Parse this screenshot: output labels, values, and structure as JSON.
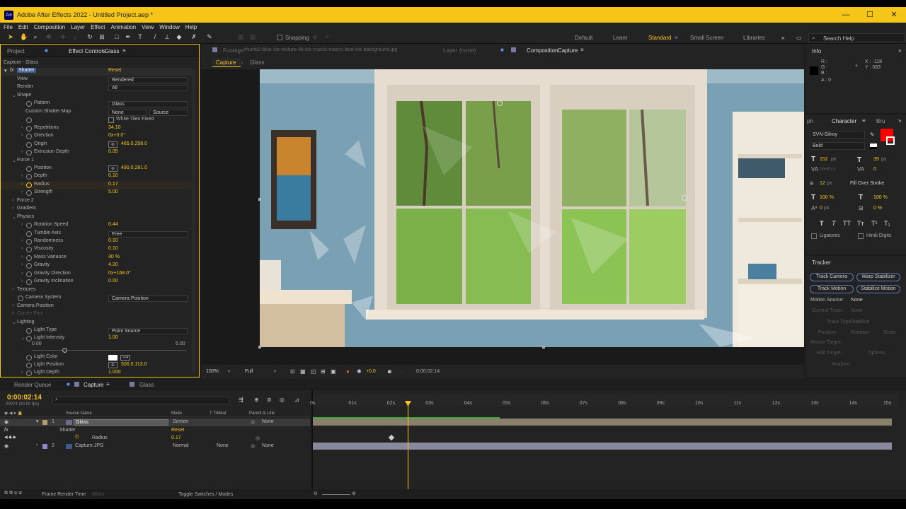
{
  "app": {
    "title": "Adobe After Effects 2022 - Untitled Project.aep *",
    "icon_text": "Ae",
    "window_buttons": [
      "—",
      "☐",
      "✕"
    ],
    "menu": [
      "File",
      "Edit",
      "Composition",
      "Layer",
      "Effect",
      "Animation",
      "View",
      "Window",
      "Help"
    ]
  },
  "toolbar": {
    "snapping_label": "Snapping",
    "workspaces": [
      "Default",
      "Learn",
      "Standard",
      "Small Screen",
      "Libraries"
    ],
    "active_workspace": "Standard",
    "search_help": "Search Help"
  },
  "effect_controls": {
    "tab_project": "Project",
    "tab_effect": "Effect Controls",
    "tab_effect_layer": "Glass",
    "breadcrumb": "Capture - Glass",
    "effect_name": "Shatter",
    "reset": "Reset",
    "rows": [
      {
        "label": "View",
        "type": "drop",
        "value": "Rendered",
        "indent": 16
      },
      {
        "label": "Render",
        "type": "drop",
        "value": "All",
        "indent": 16
      },
      {
        "label": "Shape",
        "type": "group",
        "indent": 16
      },
      {
        "label": "Pattern",
        "type": "drop",
        "value": "Glass",
        "indent": 28,
        "sw": true
      },
      {
        "label": "Custom Shatter Map",
        "type": "drop2",
        "value": "None",
        "value2": "Source",
        "indent": 28
      },
      {
        "label": "",
        "type": "check",
        "value": "White Tiles Fixed",
        "indent": 28,
        "sw": true
      },
      {
        "label": "Repetitions",
        "type": "val",
        "value": "34.10",
        "indent": 28,
        "sw": true,
        "tw": true
      },
      {
        "label": "Direction",
        "type": "val",
        "value": "0x+0.0°",
        "indent": 28,
        "sw": true,
        "tw": true
      },
      {
        "label": "Origin",
        "type": "point",
        "value": "465.0,258.0",
        "indent": 28,
        "sw": true
      },
      {
        "label": "Extrusion Depth",
        "type": "val",
        "value": "0.05",
        "indent": 28,
        "sw": true,
        "tw": true
      },
      {
        "label": "Force 1",
        "type": "group",
        "indent": 16
      },
      {
        "label": "Position",
        "type": "point",
        "value": "490.0,281.0",
        "indent": 28,
        "sw": true
      },
      {
        "label": "Depth",
        "type": "val",
        "value": "0.10",
        "indent": 28,
        "sw": true,
        "tw": true
      },
      {
        "label": "Radius",
        "type": "val",
        "value": "0.17",
        "indent": 28,
        "sw": true,
        "tw": true,
        "key": true
      },
      {
        "label": "Strength",
        "type": "val",
        "value": "5.00",
        "indent": 28,
        "sw": true,
        "tw": true
      },
      {
        "label": "Force 2",
        "type": "group",
        "indent": 16,
        "closed": true
      },
      {
        "label": "Gradient",
        "type": "group",
        "indent": 16,
        "closed": true
      },
      {
        "label": "Physics",
        "type": "group",
        "indent": 16
      },
      {
        "label": "Rotation Speed",
        "type": "val",
        "value": "0.44",
        "indent": 28,
        "sw": true,
        "tw": true
      },
      {
        "label": "Tumble Axis",
        "type": "drop",
        "value": "Free",
        "indent": 28,
        "sw": true
      },
      {
        "label": "Randomness",
        "type": "val",
        "value": "0.10",
        "indent": 28,
        "sw": true,
        "tw": true
      },
      {
        "label": "Viscosity",
        "type": "val",
        "value": "0.10",
        "indent": 28,
        "sw": true,
        "tw": true
      },
      {
        "label": "Mass Variance",
        "type": "val",
        "value": "30 %",
        "indent": 28,
        "sw": true,
        "tw": true
      },
      {
        "label": "Gravity",
        "type": "val",
        "value": "4.20",
        "indent": 28,
        "sw": true,
        "tw": true
      },
      {
        "label": "Gravity Direction",
        "type": "val",
        "value": "0x+168.0°",
        "indent": 28,
        "sw": true,
        "tw": true
      },
      {
        "label": "Gravity Inclination",
        "type": "val",
        "value": "0.00",
        "indent": 28,
        "sw": true,
        "tw": true
      },
      {
        "label": "Textures",
        "type": "group",
        "indent": 16,
        "closed": true
      },
      {
        "label": "Camera System",
        "type": "drop",
        "value": "Camera Position",
        "indent": 16,
        "sw": true
      },
      {
        "label": "Camera Position",
        "type": "group",
        "indent": 16,
        "closed": true
      },
      {
        "label": "Corner Pins",
        "type": "group",
        "indent": 16,
        "closed": true,
        "dim": true
      },
      {
        "label": "Lighting",
        "type": "group",
        "indent": 16
      },
      {
        "label": "Light Type",
        "type": "drop",
        "value": "Point Source",
        "indent": 28,
        "sw": true
      },
      {
        "label": "Light Intensity",
        "type": "val",
        "value": "1.00",
        "indent": 28,
        "sw": true,
        "tw": true,
        "open": true
      }
    ],
    "slider_min": "0.00",
    "slider_max": "5.00",
    "light_color_label": "Light Color",
    "light_position_label": "Light Position",
    "light_position_value": "506.0,113.0",
    "light_depth_label": "Light Depth",
    "light_depth_value": "1.000"
  },
  "viewer": {
    "footage_tab": "Footage",
    "footage_name": "thumb2-blue-ice-texture-4k-ice-cracks-macro-blue-ice-background.jpg",
    "layer_tab": "Layer",
    "layer_value": "(none)",
    "comp_tab": "Composition",
    "comp_name": "Capture",
    "crumb_active": "Capture",
    "crumb_next": "Glass",
    "zoom": "100%",
    "resolution": "Full",
    "exposure": "+0.0",
    "timecode": "0:00:02:14"
  },
  "info": {
    "tab": "Info",
    "r": "R :",
    "g": "G :",
    "b": "B :",
    "a": "A : 0",
    "x": "X : -118",
    "y": "Y : 583"
  },
  "character": {
    "tab_left": "ph",
    "tab": "Character",
    "tab_right": "Bru",
    "font": "SVN-Gilroy",
    "style": "Bold",
    "size": "152",
    "size_unit": "px",
    "leading": "39",
    "leading_unit": "px",
    "kerning": "Metrics",
    "tracking": "0",
    "stroke": "12",
    "stroke_unit": "px",
    "stroke_mode": "Fill Over Stroke",
    "vscale": "100 %",
    "hscale": "100 %",
    "baseline": "0",
    "baseline_unit": "px",
    "tsume": "0 %",
    "style_buttons": [
      "T",
      "T",
      "TT",
      "Tт",
      "T¹",
      "T₁"
    ],
    "ligatures": "Ligatures",
    "hindi_digits": "Hindi Digits",
    "fill_color": "#ff0000"
  },
  "tracker": {
    "tab": "Tracker",
    "track_camera": "Track Camera",
    "warp_stabilizer": "Warp Stabilizer",
    "track_motion": "Track Motion",
    "stabilize_motion": "Stabilize Motion",
    "motion_source_label": "Motion Source:",
    "motion_source_value": "None",
    "current_track_label": "Current Track:",
    "current_track_value": "None",
    "track_type_label": "Track Type:",
    "track_type_value": "Stabilize",
    "position": "Position",
    "rotation": "Rotation",
    "scale": "Scale",
    "motion_target": "Motion Target:",
    "edit_target": "Edit Target...",
    "options": "Options...",
    "analyze": "Analyze:"
  },
  "timeline": {
    "tab_render": "Render Queue",
    "tab_capture": "Capture",
    "tab_glass": "Glass",
    "timecode": "0:00:02:14",
    "frames": "00074 (30.00 fps)",
    "search_placeholder": "",
    "col_source": "Source Name",
    "col_mode": "Mode",
    "col_trkmat": "T TrkMat",
    "col_parent": "Parent & Link",
    "layers": [
      {
        "num": "1",
        "name": "Glass",
        "mode": "Screen",
        "parent": "None"
      },
      {
        "num": "2",
        "name": "Capture.JPG",
        "mode": "Normal",
        "trkmat": "None",
        "parent": "None"
      }
    ],
    "fx_label": "fx",
    "effect_label": "Shatter",
    "effect_reset": "Reset",
    "prop_label": "Radius",
    "prop_value": "0.17",
    "ruler": [
      "0s",
      "01s",
      "02s",
      "03s",
      "04s",
      "05s",
      "06s",
      "07s",
      "08s",
      "09s",
      "10s",
      "11s",
      "12s",
      "13s",
      "14s",
      "15s"
    ],
    "frame_render_label": "Frame Render Time",
    "frame_render_value": "80ms",
    "toggle_label": "Toggle Switches / Modes"
  },
  "colors": {
    "accent": "#f5c518",
    "title_bar": "#f5c518",
    "panel_bg": "#232323",
    "highlight_border": "#f5c518",
    "wall": "#7aa0b4",
    "layer_glass": "#8a7f6a",
    "layer_capture": "#8a8a9e"
  }
}
